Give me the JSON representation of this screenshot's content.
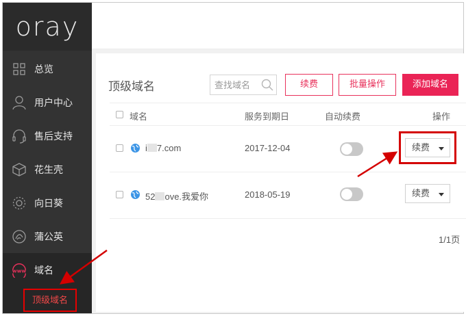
{
  "brand": {
    "logo_text": "oray"
  },
  "sidebar": {
    "items": [
      {
        "label": "总览",
        "icon": "grid-icon"
      },
      {
        "label": "用户中心",
        "icon": "user-icon"
      },
      {
        "label": "售后支持",
        "icon": "headset-icon"
      },
      {
        "label": "花生壳",
        "icon": "cube-icon"
      },
      {
        "label": "向日葵",
        "icon": "sunflower-icon"
      },
      {
        "label": "蒲公英",
        "icon": "dandelion-icon"
      },
      {
        "label": "域名",
        "icon": "www-icon",
        "active": true
      }
    ],
    "sub_item": {
      "label": "顶级域名"
    }
  },
  "page": {
    "title": "顶级域名",
    "search": {
      "placeholder": "查找域名"
    },
    "buttons": {
      "renew": "续费",
      "batch": "批量操作",
      "add": "添加域名"
    }
  },
  "table": {
    "headers": {
      "domain": "域名",
      "expiry": "服务到期日",
      "auto_renew": "自动续费",
      "action": "操作"
    },
    "rows": [
      {
        "domain_prefix": "i",
        "domain_suffix": "7.com",
        "expiry": "2017-12-04",
        "auto_renew": false,
        "action": "续费"
      },
      {
        "domain_prefix": "52",
        "domain_suffix": "ove.我爱你",
        "expiry": "2018-05-19",
        "auto_renew": false,
        "action": "续费"
      }
    ]
  },
  "pagination": {
    "text": "1/1页"
  },
  "colors": {
    "sidebar_bg": "#333333",
    "accent": "#ea2456",
    "annotation": "#d40000",
    "globe": "#3c95e6"
  }
}
